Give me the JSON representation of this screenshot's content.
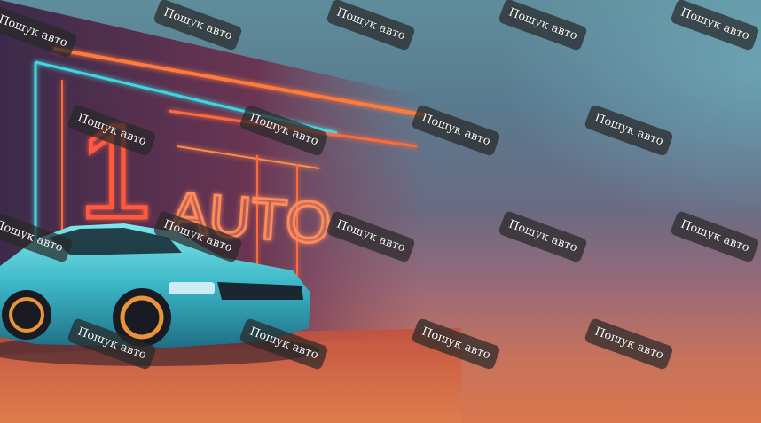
{
  "banner": {
    "sign_text": "1AUTO",
    "watermark_text": "Пошук авто"
  },
  "colors": {
    "sky_top": "#5f8d9b",
    "sky_mid": "#6a6a82",
    "ground": "#d9774d",
    "neon_red": "#ff5a3c",
    "neon_cyan": "#3fd6df",
    "car_body": "#5ad0d8"
  },
  "watermarks": [
    {
      "label": "Пошук авто"
    },
    {
      "label": "Пошук авто"
    },
    {
      "label": "Пошук авто"
    },
    {
      "label": "Пошук авто"
    },
    {
      "label": "Пошук авто"
    },
    {
      "label": "Пошук авто"
    },
    {
      "label": "Пошук авто"
    },
    {
      "label": "Пошук авто"
    },
    {
      "label": "Пошук авто"
    },
    {
      "label": "Пошук авто"
    },
    {
      "label": "Пошук авто"
    },
    {
      "label": "Пошук авто"
    },
    {
      "label": "Пошук авто"
    },
    {
      "label": "Пошук авто"
    },
    {
      "label": "Пошук авто"
    },
    {
      "label": "Пошук авто"
    },
    {
      "label": "Пошук авто"
    },
    {
      "label": "Пошук авто"
    }
  ]
}
